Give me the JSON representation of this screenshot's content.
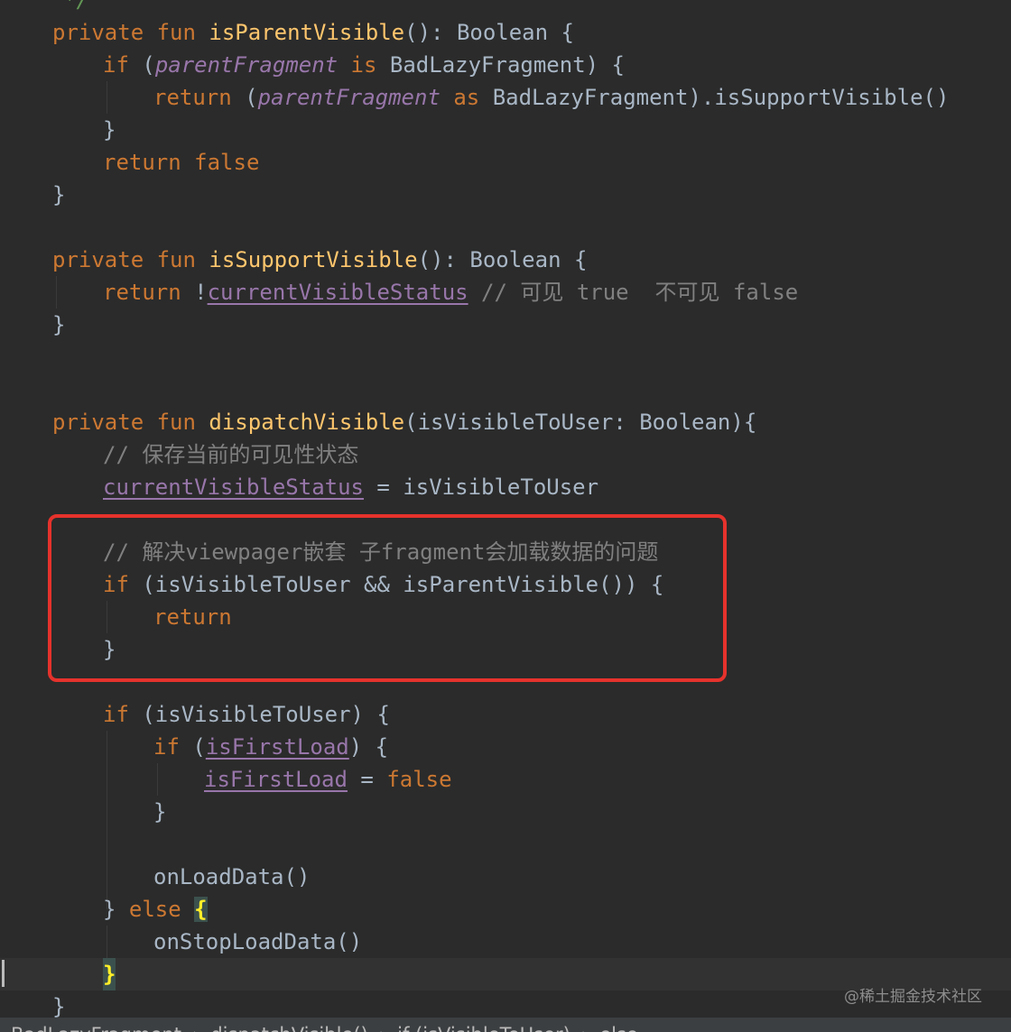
{
  "editor": {
    "lines": {
      "l0": {
        "text": "*/"
      },
      "l1": {
        "a": "private fun ",
        "b": "isParentVisible",
        "c": "(): Boolean {"
      },
      "l2": {
        "a": "if ",
        "b": "(",
        "c": "parentFragment",
        "d": " is ",
        "e": "BadLazyFragment) {"
      },
      "l3": {
        "a": "return ",
        "b": "(",
        "c": "parentFragment",
        "d": " as ",
        "e": "BadLazyFragment).isSupportVisible()"
      },
      "l4": {
        "a": "}"
      },
      "l5": {
        "a": "return false"
      },
      "l6": {
        "a": "}"
      },
      "l8": {
        "a": "private fun ",
        "b": "isSupportVisible",
        "c": "(): Boolean {"
      },
      "l9": {
        "a": "return ",
        "b": "!",
        "c": "currentVisibleStatus",
        "d": " // 可见 true  不可见 false"
      },
      "l10": {
        "a": "}"
      },
      "l13": {
        "a": "private fun ",
        "b": "dispatchVisible",
        "c": "(isVisibleToUser: Boolean){"
      },
      "l14": {
        "a": "// 保存当前的可见性状态"
      },
      "l15": {
        "a": "currentVisibleStatus",
        "b": " = isVisibleToUser"
      },
      "l17": {
        "a": "// 解决viewpager嵌套 子fragment会加载数据的问题"
      },
      "l18": {
        "a": "if ",
        "b": "(isVisibleToUser && isParentVisible()) {"
      },
      "l19": {
        "a": "return"
      },
      "l20": {
        "a": "}"
      },
      "l22": {
        "a": "if ",
        "b": "(isVisibleToUser) {"
      },
      "l23": {
        "a": "if ",
        "b": "(",
        "c": "isFirstLoad",
        "d": ") {"
      },
      "l24": {
        "a": "isFirstLoad",
        "b": " = ",
        "c": "false"
      },
      "l25": {
        "a": "}"
      },
      "l27": {
        "a": "onLoadData()"
      },
      "l28": {
        "a": "} ",
        "b": "else ",
        "c": "{"
      },
      "l29": {
        "a": "onStopLoadData()"
      },
      "l30": {
        "a": "}"
      },
      "l31": {
        "a": "}"
      }
    }
  },
  "watermark": "@稀土掘金技术社区",
  "breadcrumb": {
    "items": [
      "BadLazyFragment",
      "dispatchVisible()",
      "if (isVisibleToUser)",
      "else"
    ],
    "separator": "›"
  },
  "colors": {
    "background": "#2b2b2b",
    "keyword": "#cc7832",
    "function": "#ffc66d",
    "property": "#9876aa",
    "comment": "#808080",
    "highlight_box": "#e6322c"
  }
}
